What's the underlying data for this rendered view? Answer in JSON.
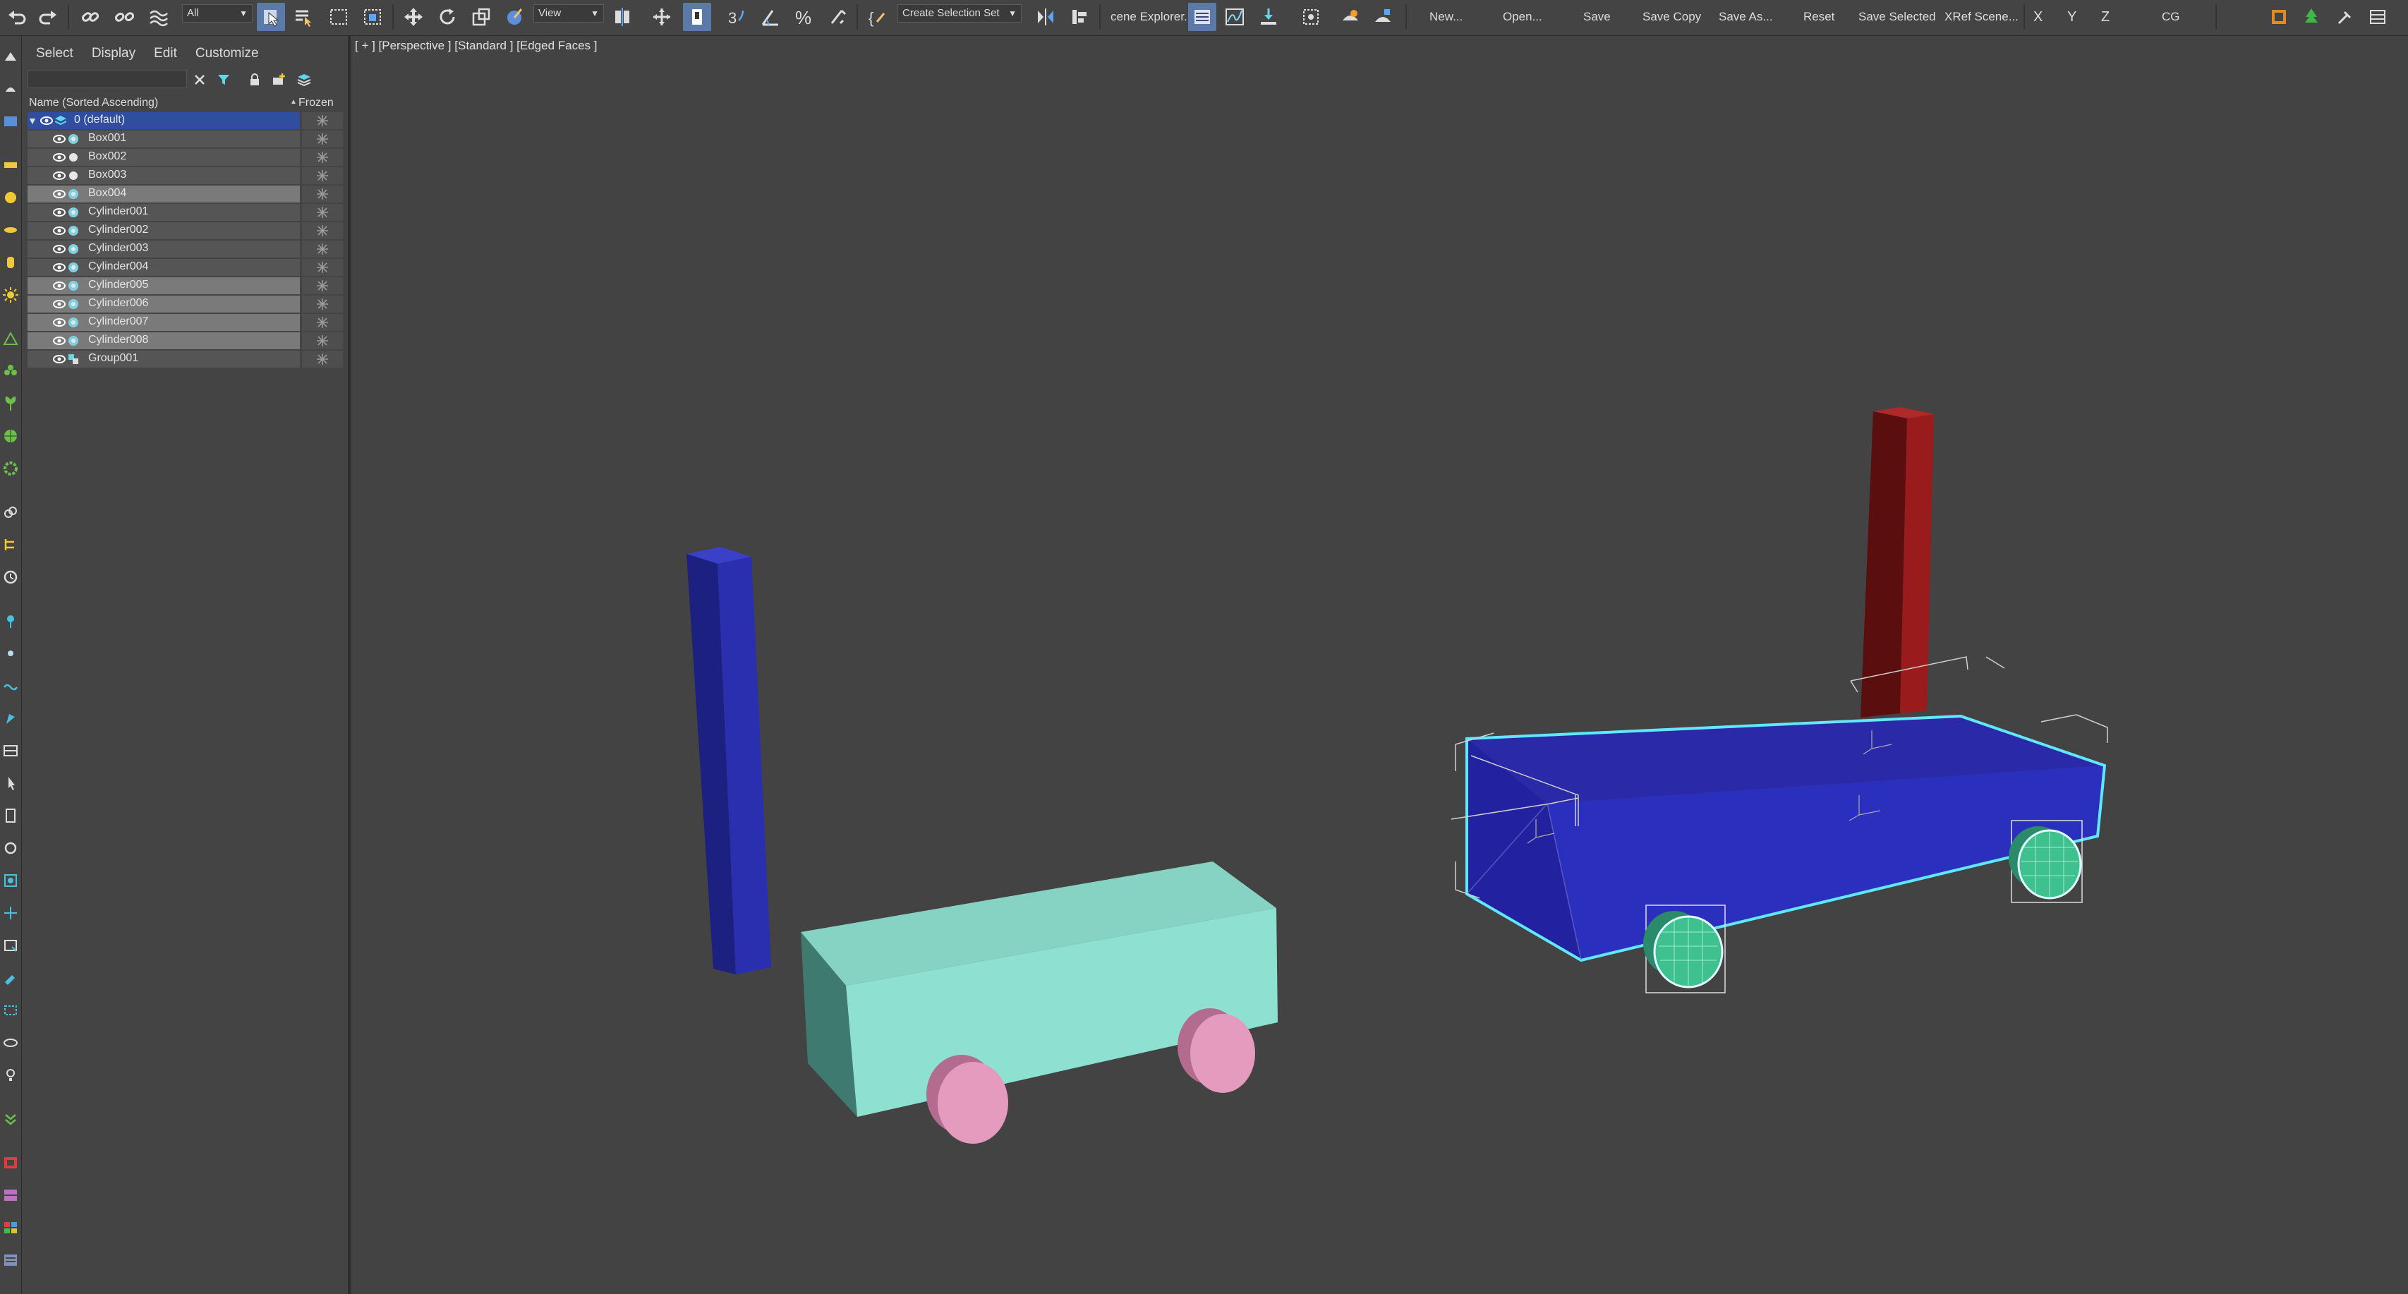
{
  "toolbar": {
    "filter_dropdown": "All",
    "ref_coord_dropdown": "View",
    "named_selection": "Create Selection Set",
    "scene_explorer_btn": "cene Explorer.",
    "new": "New...",
    "open": "Open...",
    "save": "Save",
    "save_copy": "Save Copy",
    "save_as": "Save As...",
    "reset": "Reset",
    "save_selected": "Save Selected",
    "xref_scene": "XRef Scene...",
    "axis_x": "X",
    "axis_y": "Y",
    "axis_z": "Z",
    "cg": "CG"
  },
  "explorer": {
    "menus": [
      "Select",
      "Display",
      "Edit",
      "Customize"
    ],
    "search_value": "",
    "column_name": "Name (Sorted Ascending)",
    "column_frozen": "Frozen",
    "layer": "0 (default)",
    "items": [
      {
        "label": "Box001",
        "highlight": false
      },
      {
        "label": "Box002",
        "highlight": false
      },
      {
        "label": "Box003",
        "highlight": false
      },
      {
        "label": "Box004",
        "highlight": true
      },
      {
        "label": "Cylinder001",
        "highlight": false
      },
      {
        "label": "Cylinder002",
        "highlight": false
      },
      {
        "label": "Cylinder003",
        "highlight": false
      },
      {
        "label": "Cylinder004",
        "highlight": false
      },
      {
        "label": "Cylinder005",
        "highlight": true
      },
      {
        "label": "Cylinder006",
        "highlight": true
      },
      {
        "label": "Cylinder007",
        "highlight": true
      },
      {
        "label": "Cylinder008",
        "highlight": true
      },
      {
        "label": "Group001",
        "highlight": false
      }
    ]
  },
  "viewport": {
    "label": "[ + ] [Perspective ] [Standard ] [Edged Faces ]"
  },
  "colors": {
    "selected_blue": "#2f4f9e",
    "highlight_row": "#7a7a7a",
    "row_bg": "#555555",
    "cyan_box": "#86d6c8",
    "pink_wheel": "#e597bc",
    "blue_box": "#2a2fb0",
    "red_post": "#9a1b1b",
    "green_wheel": "#3fc08f",
    "selection_cyan": "#5fe8ff"
  }
}
